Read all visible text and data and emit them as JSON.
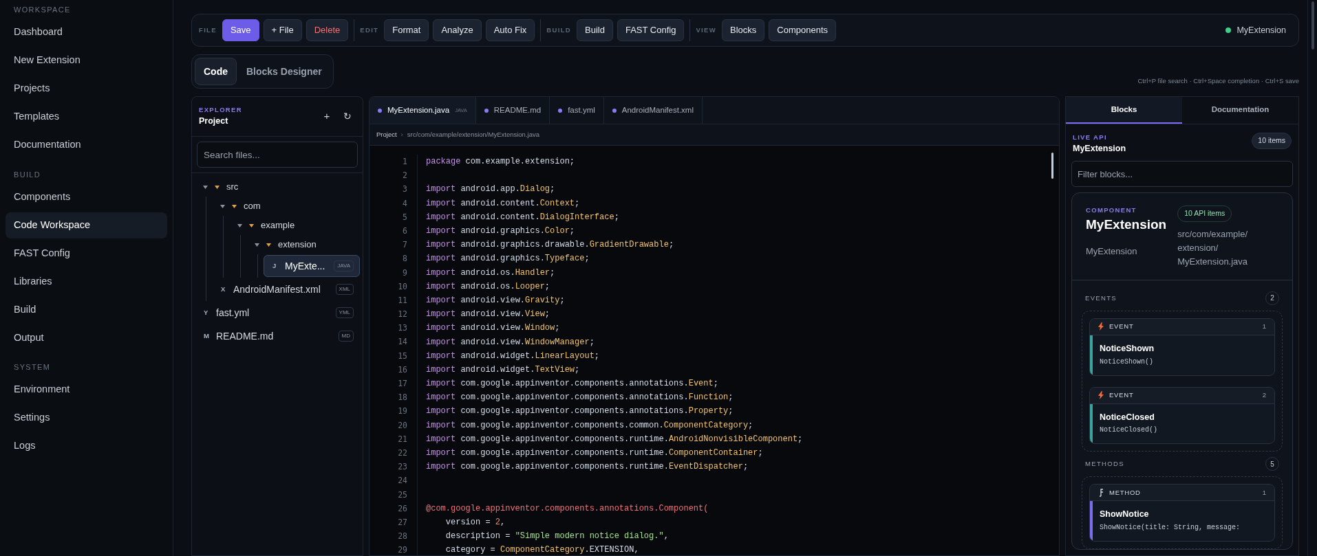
{
  "sidebar": {
    "sections": [
      {
        "title": "WORKSPACE",
        "items": [
          {
            "label": "Dashboard",
            "selected": false
          },
          {
            "label": "New Extension",
            "selected": false
          },
          {
            "label": "Projects",
            "selected": false
          },
          {
            "label": "Templates",
            "selected": false
          },
          {
            "label": "Documentation",
            "selected": false
          }
        ]
      },
      {
        "title": "BUILD",
        "items": [
          {
            "label": "Components",
            "selected": false
          },
          {
            "label": "Code Workspace",
            "selected": true
          },
          {
            "label": "FAST Config",
            "selected": false
          },
          {
            "label": "Libraries",
            "selected": false
          },
          {
            "label": "Build",
            "selected": false
          },
          {
            "label": "Output",
            "selected": false
          }
        ]
      },
      {
        "title": "SYSTEM",
        "items": [
          {
            "label": "Environment",
            "selected": false
          },
          {
            "label": "Settings",
            "selected": false
          },
          {
            "label": "Logs",
            "selected": false
          }
        ]
      }
    ]
  },
  "toolbar": {
    "groups": [
      {
        "label": "FILE",
        "buttons": [
          {
            "label": "Save",
            "kind": "primary"
          },
          {
            "label": "+ File",
            "kind": "default"
          },
          {
            "label": "Delete",
            "kind": "danger"
          }
        ]
      },
      {
        "label": "EDIT",
        "buttons": [
          {
            "label": "Format",
            "kind": "default"
          },
          {
            "label": "Analyze",
            "kind": "default"
          },
          {
            "label": "Auto Fix",
            "kind": "default"
          }
        ]
      },
      {
        "label": "BUILD",
        "buttons": [
          {
            "label": "Build",
            "kind": "default"
          },
          {
            "label": "FAST Config",
            "kind": "default"
          }
        ]
      },
      {
        "label": "VIEW",
        "buttons": [
          {
            "label": "Blocks",
            "kind": "default"
          },
          {
            "label": "Components",
            "kind": "default"
          }
        ]
      }
    ],
    "status": "MyExtension"
  },
  "mode_tabs": [
    {
      "label": "Code",
      "selected": true
    },
    {
      "label": "Blocks Designer",
      "selected": false
    }
  ],
  "shortcuts_hint": "Ctrl+P file search · Ctrl+Space completion · Ctrl+S save",
  "explorer": {
    "eyebrow": "EXPLORER",
    "title": "Project",
    "add": "+",
    "refresh": "↻",
    "search_placeholder": "Search files...",
    "tree": [
      {
        "kind": "folder",
        "name": "src",
        "expanded": true,
        "children": [
          {
            "kind": "folder",
            "name": "com",
            "expanded": true,
            "children": [
              {
                "kind": "folder",
                "name": "example",
                "expanded": true,
                "children": [
                  {
                    "kind": "folder",
                    "name": "extension",
                    "expanded": true,
                    "children": [
                      {
                        "kind": "file",
                        "icon": "J",
                        "name": "MyExte...",
                        "badge": "JAVA",
                        "selected": true
                      }
                    ]
                  }
                ]
              }
            ]
          },
          {
            "kind": "file",
            "icon": "X",
            "name": "AndroidManifest.xml",
            "badge": "XML",
            "selected": false
          }
        ]
      },
      {
        "kind": "file",
        "icon": "Y",
        "name": "fast.yml",
        "badge": "YML",
        "selected": false
      },
      {
        "kind": "file",
        "icon": "M",
        "name": "README.md",
        "badge": "MD",
        "selected": false
      }
    ]
  },
  "editor": {
    "tabs": [
      {
        "label": "MyExtension.java",
        "badge": "JAVA",
        "selected": true
      },
      {
        "label": "README.md",
        "selected": false
      },
      {
        "label": "fast.yml",
        "selected": false
      },
      {
        "label": "AndroidManifest.xml",
        "selected": false
      }
    ],
    "breadcrumb": {
      "root": "Project",
      "separator": "›",
      "path": "src/com/example/extension/MyExtension.java"
    },
    "lines": [
      {
        "n": "1",
        "tokens": [
          {
            "kind": "kw",
            "text": "package"
          },
          {
            "kind": "p",
            "text": " com.example.extension;"
          }
        ]
      },
      {
        "n": "2"
      },
      {
        "n": "3",
        "tokens": [
          {
            "kind": "kw",
            "text": "import"
          },
          {
            "kind": "p",
            "text": " android.app."
          },
          {
            "kind": "ty",
            "text": "Dialog"
          },
          {
            "kind": "p",
            "text": ";"
          }
        ]
      },
      {
        "n": "4",
        "tokens": [
          {
            "kind": "kw",
            "text": "import"
          },
          {
            "kind": "p",
            "text": " android.content."
          },
          {
            "kind": "ty",
            "text": "Context"
          },
          {
            "kind": "p",
            "text": ";"
          }
        ]
      },
      {
        "n": "5",
        "tokens": [
          {
            "kind": "kw",
            "text": "import"
          },
          {
            "kind": "p",
            "text": " android.content."
          },
          {
            "kind": "ty",
            "text": "DialogInterface"
          },
          {
            "kind": "p",
            "text": ";"
          }
        ]
      },
      {
        "n": "6",
        "tokens": [
          {
            "kind": "kw",
            "text": "import"
          },
          {
            "kind": "p",
            "text": " android.graphics."
          },
          {
            "kind": "ty",
            "text": "Color"
          },
          {
            "kind": "p",
            "text": ";"
          }
        ]
      },
      {
        "n": "7",
        "tokens": [
          {
            "kind": "kw",
            "text": "import"
          },
          {
            "kind": "p",
            "text": " android.graphics.drawable."
          },
          {
            "kind": "ty",
            "text": "GradientDrawable"
          },
          {
            "kind": "p",
            "text": ";"
          }
        ]
      },
      {
        "n": "8",
        "tokens": [
          {
            "kind": "kw",
            "text": "import"
          },
          {
            "kind": "p",
            "text": " android.graphics."
          },
          {
            "kind": "ty",
            "text": "Typeface"
          },
          {
            "kind": "p",
            "text": ";"
          }
        ]
      },
      {
        "n": "9",
        "tokens": [
          {
            "kind": "kw",
            "text": "import"
          },
          {
            "kind": "p",
            "text": " android.os."
          },
          {
            "kind": "ty",
            "text": "Handler"
          },
          {
            "kind": "p",
            "text": ";"
          }
        ]
      },
      {
        "n": "10",
        "tokens": [
          {
            "kind": "kw",
            "text": "import"
          },
          {
            "kind": "p",
            "text": " android.os."
          },
          {
            "kind": "ty",
            "text": "Looper"
          },
          {
            "kind": "p",
            "text": ";"
          }
        ]
      },
      {
        "n": "11",
        "tokens": [
          {
            "kind": "kw",
            "text": "import"
          },
          {
            "kind": "p",
            "text": " android.view."
          },
          {
            "kind": "ty",
            "text": "Gravity"
          },
          {
            "kind": "p",
            "text": ";"
          }
        ]
      },
      {
        "n": "12",
        "tokens": [
          {
            "kind": "kw",
            "text": "import"
          },
          {
            "kind": "p",
            "text": " android.view."
          },
          {
            "kind": "ty",
            "text": "View"
          },
          {
            "kind": "p",
            "text": ";"
          }
        ]
      },
      {
        "n": "13",
        "tokens": [
          {
            "kind": "kw",
            "text": "import"
          },
          {
            "kind": "p",
            "text": " android.view."
          },
          {
            "kind": "ty",
            "text": "Window"
          },
          {
            "kind": "p",
            "text": ";"
          }
        ]
      },
      {
        "n": "14",
        "tokens": [
          {
            "kind": "kw",
            "text": "import"
          },
          {
            "kind": "p",
            "text": " android.view."
          },
          {
            "kind": "ty",
            "text": "WindowManager"
          },
          {
            "kind": "p",
            "text": ";"
          }
        ]
      },
      {
        "n": "15",
        "tokens": [
          {
            "kind": "kw",
            "text": "import"
          },
          {
            "kind": "p",
            "text": " android.widget."
          },
          {
            "kind": "ty",
            "text": "LinearLayout"
          },
          {
            "kind": "p",
            "text": ";"
          }
        ]
      },
      {
        "n": "16",
        "tokens": [
          {
            "kind": "kw",
            "text": "import"
          },
          {
            "kind": "p",
            "text": " android.widget."
          },
          {
            "kind": "ty",
            "text": "TextView"
          },
          {
            "kind": "p",
            "text": ";"
          }
        ]
      },
      {
        "n": "17",
        "tokens": [
          {
            "kind": "kw",
            "text": "import"
          },
          {
            "kind": "p",
            "text": " com.google.appinventor.components.annotations."
          },
          {
            "kind": "ty",
            "text": "Event"
          },
          {
            "kind": "p",
            "text": ";"
          }
        ]
      },
      {
        "n": "18",
        "tokens": [
          {
            "kind": "kw",
            "text": "import"
          },
          {
            "kind": "p",
            "text": " com.google.appinventor.components.annotations."
          },
          {
            "kind": "ty",
            "text": "Function"
          },
          {
            "kind": "p",
            "text": ";"
          }
        ]
      },
      {
        "n": "19",
        "tokens": [
          {
            "kind": "kw",
            "text": "import"
          },
          {
            "kind": "p",
            "text": " com.google.appinventor.components.annotations."
          },
          {
            "kind": "ty",
            "text": "Property"
          },
          {
            "kind": "p",
            "text": ";"
          }
        ]
      },
      {
        "n": "20",
        "tokens": [
          {
            "kind": "kw",
            "text": "import"
          },
          {
            "kind": "p",
            "text": " com.google.appinventor.components.common."
          },
          {
            "kind": "ty",
            "text": "ComponentCategory"
          },
          {
            "kind": "p",
            "text": ";"
          }
        ]
      },
      {
        "n": "21",
        "tokens": [
          {
            "kind": "kw",
            "text": "import"
          },
          {
            "kind": "p",
            "text": " com.google.appinventor.components.runtime."
          },
          {
            "kind": "ty",
            "text": "AndroidNonvisibleComponent"
          },
          {
            "kind": "p",
            "text": ";"
          }
        ]
      },
      {
        "n": "22",
        "tokens": [
          {
            "kind": "kw",
            "text": "import"
          },
          {
            "kind": "p",
            "text": " com.google.appinventor.components.runtime."
          },
          {
            "kind": "ty",
            "text": "ComponentContainer"
          },
          {
            "kind": "p",
            "text": ";"
          }
        ]
      },
      {
        "n": "23",
        "tokens": [
          {
            "kind": "kw",
            "text": "import"
          },
          {
            "kind": "p",
            "text": " com.google.appinventor.components.runtime."
          },
          {
            "kind": "ty",
            "text": "EventDispatcher"
          },
          {
            "kind": "p",
            "text": ";"
          }
        ]
      },
      {
        "n": "24"
      },
      {
        "n": "25"
      },
      {
        "n": "26",
        "tokens": [
          {
            "kind": "an",
            "text": "@com.google.appinventor.components.annotations.Component("
          }
        ]
      },
      {
        "n": "27",
        "tokens": [
          {
            "kind": "p",
            "text": "    version = "
          },
          {
            "kind": "num",
            "text": "2"
          },
          {
            "kind": "p",
            "text": ","
          }
        ]
      },
      {
        "n": "28",
        "tokens": [
          {
            "kind": "p",
            "text": "    description = "
          },
          {
            "kind": "str",
            "text": "\"Simple modern notice dialog.\""
          },
          {
            "kind": "p",
            "text": ","
          }
        ]
      },
      {
        "n": "29",
        "tokens": [
          {
            "kind": "p",
            "text": "    category = "
          },
          {
            "kind": "ty",
            "text": "ComponentCategory"
          },
          {
            "kind": "p",
            "text": ".EXTENSION,"
          }
        ]
      }
    ]
  },
  "api_panel": {
    "tabs": [
      {
        "label": "Blocks",
        "selected": true
      },
      {
        "label": "Documentation",
        "selected": false
      }
    ],
    "eyebrow": "LIVE API",
    "title": "MyExtension",
    "count": "10 items",
    "filter_placeholder": "Filter blocks...",
    "component": {
      "eyebrow": "COMPONENT",
      "name": "MyExtension",
      "subtitle": "MyExtension",
      "api_count": "10 API items",
      "path": "src/com/example/extension/MyExtension.java"
    },
    "sections": [
      {
        "title": "EVENTS",
        "count": "2",
        "blocks": [
          {
            "kind": "event",
            "label": "EVENT",
            "index": "1",
            "name": "NoticeShown",
            "signature": "NoticeShown()"
          },
          {
            "kind": "event",
            "label": "EVENT",
            "index": "2",
            "name": "NoticeClosed",
            "signature": "NoticeClosed()"
          }
        ]
      },
      {
        "title": "METHODS",
        "count": "5",
        "blocks": [
          {
            "kind": "method",
            "label": "METHOD",
            "index": "1",
            "name": "ShowNotice",
            "signature": "ShowNotice(title: String, message:"
          }
        ]
      }
    ]
  }
}
